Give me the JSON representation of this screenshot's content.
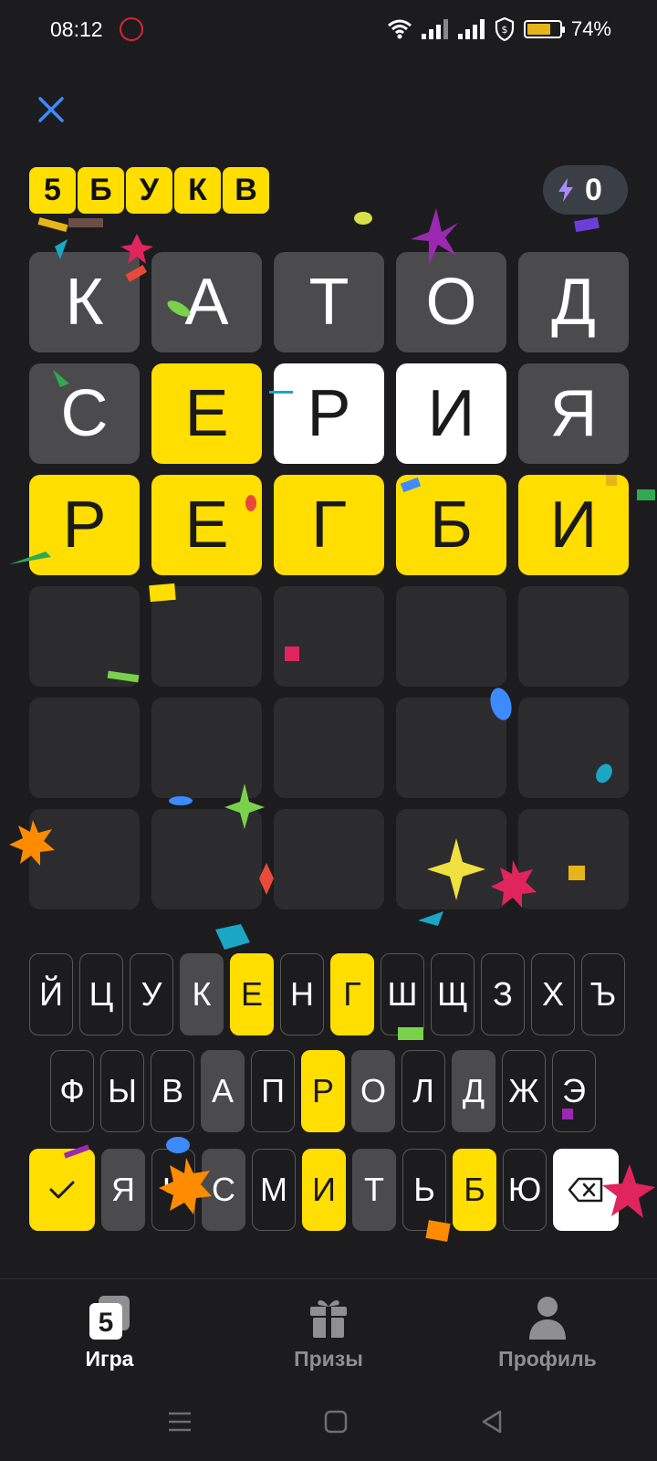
{
  "status_bar": {
    "time": "08:12",
    "battery_percent": "74%",
    "battery_level": 0.74
  },
  "word_length": [
    "5",
    "Б",
    "У",
    "К",
    "В"
  ],
  "energy": {
    "count": "0"
  },
  "board": [
    [
      {
        "letter": "К",
        "state": "absent"
      },
      {
        "letter": "А",
        "state": "absent"
      },
      {
        "letter": "Т",
        "state": "absent"
      },
      {
        "letter": "О",
        "state": "absent"
      },
      {
        "letter": "Д",
        "state": "absent"
      }
    ],
    [
      {
        "letter": "С",
        "state": "absent"
      },
      {
        "letter": "Е",
        "state": "present"
      },
      {
        "letter": "Р",
        "state": "correct"
      },
      {
        "letter": "И",
        "state": "correct"
      },
      {
        "letter": "Я",
        "state": "absent"
      }
    ],
    [
      {
        "letter": "Р",
        "state": "present"
      },
      {
        "letter": "Е",
        "state": "present"
      },
      {
        "letter": "Г",
        "state": "present"
      },
      {
        "letter": "Б",
        "state": "present"
      },
      {
        "letter": "И",
        "state": "present"
      }
    ],
    [
      {
        "letter": "",
        "state": "empty"
      },
      {
        "letter": "",
        "state": "empty"
      },
      {
        "letter": "",
        "state": "empty"
      },
      {
        "letter": "",
        "state": "empty"
      },
      {
        "letter": "",
        "state": "empty"
      }
    ],
    [
      {
        "letter": "",
        "state": "empty"
      },
      {
        "letter": "",
        "state": "empty"
      },
      {
        "letter": "",
        "state": "empty"
      },
      {
        "letter": "",
        "state": "empty"
      },
      {
        "letter": "",
        "state": "empty"
      }
    ],
    [
      {
        "letter": "",
        "state": "empty"
      },
      {
        "letter": "",
        "state": "empty"
      },
      {
        "letter": "",
        "state": "empty"
      },
      {
        "letter": "",
        "state": "empty"
      },
      {
        "letter": "",
        "state": "empty"
      }
    ]
  ],
  "keyboard": {
    "row1": [
      {
        "k": "Й",
        "s": "unused"
      },
      {
        "k": "Ц",
        "s": "unused"
      },
      {
        "k": "У",
        "s": "unused"
      },
      {
        "k": "К",
        "s": "absent"
      },
      {
        "k": "Е",
        "s": "present"
      },
      {
        "k": "Н",
        "s": "unused"
      },
      {
        "k": "Г",
        "s": "present"
      },
      {
        "k": "Ш",
        "s": "unused"
      },
      {
        "k": "Щ",
        "s": "unused"
      },
      {
        "k": "З",
        "s": "unused"
      },
      {
        "k": "Х",
        "s": "unused"
      },
      {
        "k": "Ъ",
        "s": "unused"
      }
    ],
    "row2": [
      {
        "k": "Ф",
        "s": "unused"
      },
      {
        "k": "Ы",
        "s": "unused"
      },
      {
        "k": "В",
        "s": "unused"
      },
      {
        "k": "А",
        "s": "absent"
      },
      {
        "k": "П",
        "s": "unused"
      },
      {
        "k": "Р",
        "s": "present"
      },
      {
        "k": "О",
        "s": "absent"
      },
      {
        "k": "Л",
        "s": "unused"
      },
      {
        "k": "Д",
        "s": "absent"
      },
      {
        "k": "Ж",
        "s": "unused"
      },
      {
        "k": "Э",
        "s": "unused"
      }
    ],
    "row3": [
      {
        "k": "Я",
        "s": "absent"
      },
      {
        "k": "Ч",
        "s": "unused"
      },
      {
        "k": "С",
        "s": "absent"
      },
      {
        "k": "М",
        "s": "unused"
      },
      {
        "k": "И",
        "s": "present"
      },
      {
        "k": "Т",
        "s": "absent"
      },
      {
        "k": "Ь",
        "s": "unused"
      },
      {
        "k": "Б",
        "s": "present"
      },
      {
        "k": "Ю",
        "s": "unused"
      }
    ]
  },
  "nav": {
    "game": "Игра",
    "prizes": "Призы",
    "profile": "Профиль",
    "game_icon_digit": "5"
  },
  "colors": {
    "accent": "#ffde00",
    "absent": "#4b4b4d",
    "empty": "#2c2c2e",
    "background": "#1c1c1e"
  }
}
